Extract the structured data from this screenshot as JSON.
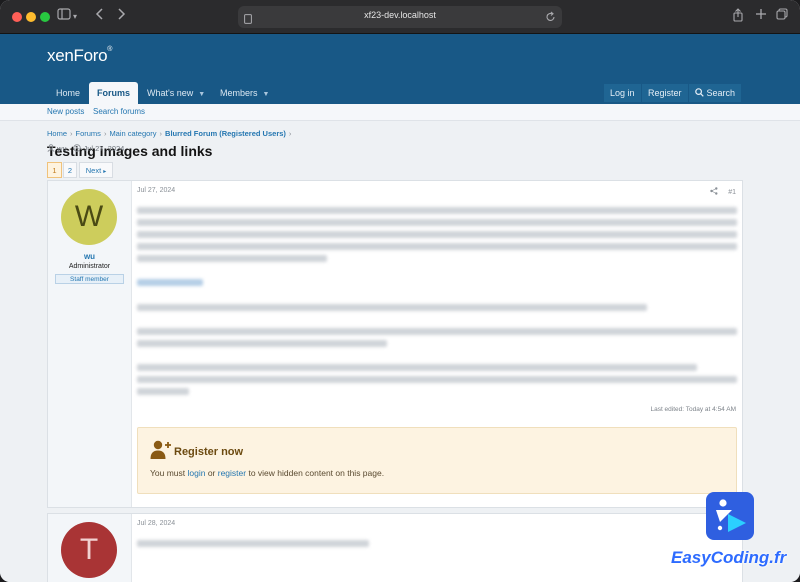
{
  "browser": {
    "url": "xf23-dev.localhost",
    "icons": [
      "sidebar-icon",
      "back-icon",
      "forward-icon",
      "page-icon",
      "reload-icon",
      "share-icon",
      "new-tab-icon",
      "tabs-icon"
    ]
  },
  "site": {
    "logo_main": "xenForo",
    "logo_tm": "®"
  },
  "nav": {
    "tabs": [
      {
        "label": "Home"
      },
      {
        "label": "Forums"
      },
      {
        "label": "What's new"
      },
      {
        "label": "Members"
      }
    ],
    "login": "Log in",
    "register": "Register",
    "search": "Search"
  },
  "subnav": {
    "new_posts": "New posts",
    "search_forums": "Search forums"
  },
  "breadcrumb": {
    "items": [
      "Home",
      "Forums",
      "Main category",
      "Blurred Forum (Registered Users)"
    ]
  },
  "thread": {
    "title": "Testing images and links",
    "author": "wu",
    "date": "Jul 27, 2024"
  },
  "pagination": {
    "pages": [
      "1",
      "2"
    ],
    "current": "1",
    "next": "Next"
  },
  "posts": [
    {
      "avatar_letter": "W",
      "username": "wu",
      "user_title": "Administrator",
      "banner": "Staff member",
      "date": "Jul 27, 2024",
      "number": "#1",
      "last_edited": "Last edited: Today at 4:54 AM",
      "register_title": "Register now",
      "register_text_1": "You must ",
      "register_login": "login",
      "register_text_2": " or ",
      "register_register": "register",
      "register_text_3": " to view hidden content on this page."
    },
    {
      "avatar_letter": "T",
      "date": "Jul 28, 2024"
    }
  ],
  "watermark": {
    "brand": "EasyCoding.fr"
  },
  "colors": {
    "header": "#185886",
    "link": "#2577b1",
    "register_bg": "#fdf3e1"
  }
}
